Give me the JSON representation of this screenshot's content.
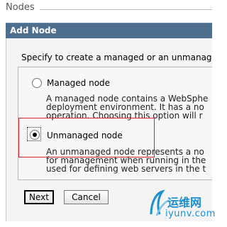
{
  "breadcrumb": {
    "label": "Nodes"
  },
  "dialog": {
    "title": "Add Node",
    "intro": "Specify to create a managed or an unmanag",
    "options": [
      {
        "label": "Managed node",
        "selected": false,
        "description": [
          "A managed node contains a WebSphe",
          "deployment environment. It has a no",
          "operation. Choosing this option will r"
        ]
      },
      {
        "label": "Unmanaged node",
        "selected": true,
        "description": [
          "An unmanaged node represents a no",
          "for management when running in the",
          "used for defining web servers in the t"
        ]
      }
    ],
    "buttons": {
      "next": "Next",
      "cancel": "Cancel"
    }
  },
  "watermark": {
    "text_cn": "运维网",
    "url": "iyunv.com",
    "color": "#1c8fcf"
  },
  "colors": {
    "title_bar": "#4e6e90",
    "highlight": "#d9252b"
  }
}
